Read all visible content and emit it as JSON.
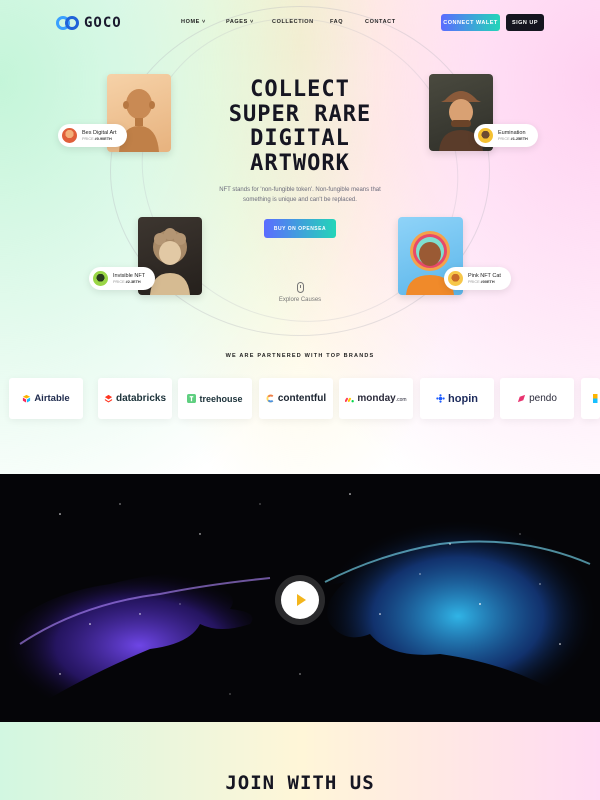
{
  "brand": {
    "name": "GOCO"
  },
  "nav": [
    {
      "label": "HOME",
      "caret": "˅"
    },
    {
      "label": "PAGES",
      "caret": "˅"
    },
    {
      "label": "COLLECTION",
      "caret": ""
    },
    {
      "label": "FAQ",
      "caret": ""
    },
    {
      "label": "CONTACT",
      "caret": ""
    }
  ],
  "header_buttons": {
    "connect": "CONNECT WALET",
    "signup": "SIGN UP"
  },
  "hero": {
    "title_lines": [
      "COLLECT",
      "SUPER RARE",
      "DIGITAL",
      "ARTWORK"
    ],
    "description": "NFT stands for 'non-fungible token'. Non-fungible means that something is unique and can't be replaced.",
    "cta": "BUY ON OPENSEA",
    "explore": "Explore Causes"
  },
  "nft_cards": [
    {
      "name": "Bes Digital Art",
      "price_label": "PRICE",
      "price": "#0.90ETH"
    },
    {
      "name": "Eumination",
      "price_label": "PRICE",
      "price": "#1.25ETH"
    },
    {
      "name": "Invisible NFT",
      "price_label": "PRICE",
      "price": "#2.3ETH"
    },
    {
      "name": "Pink NFT Cat",
      "price_label": "PRICE",
      "price": "#00ETH"
    }
  ],
  "partners": {
    "title": "WE ARE PARTNERED WITH TOP BRANDS",
    "logos": [
      {
        "name": "Airtable",
        "icon": "airtable-icon",
        "color": "#1f2b4d"
      },
      {
        "name": "databricks",
        "icon": "databricks-icon",
        "color": "#1b3139"
      },
      {
        "name": "treehouse",
        "icon": "treehouse-icon",
        "color": "#1b3139"
      },
      {
        "name": "contentful",
        "icon": "contentful-icon",
        "color": "#1b2430"
      },
      {
        "name": "monday",
        "suffix": ".com",
        "icon": "monday-icon",
        "color": "#2b2b3b"
      },
      {
        "name": "hopin",
        "icon": "hopin-icon",
        "color": "#1d2b5c"
      },
      {
        "name": "pendo",
        "icon": "pendo-icon",
        "color": "#2b2b3b"
      }
    ]
  },
  "video": {
    "play_icon": "play-icon"
  },
  "join": {
    "title": "JOIN WITH US"
  },
  "colors": {
    "accent_start": "#5b6cff",
    "accent_end": "#23d5b8",
    "dark": "#15151f",
    "play": "#f3b51c"
  }
}
